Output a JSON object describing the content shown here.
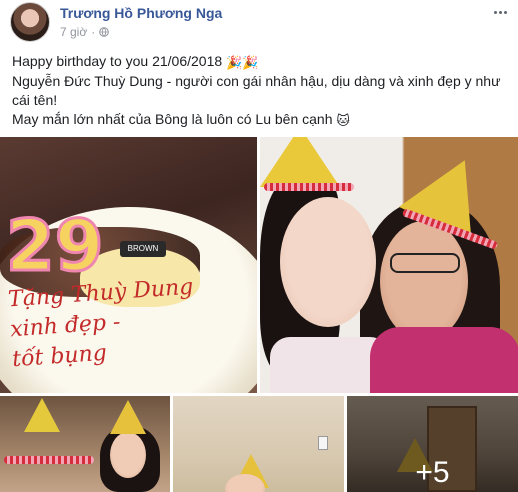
{
  "post": {
    "author": "Trương Hồ Phương Nga",
    "time": "7 giờ",
    "separator": "·",
    "privacy_icon": "globe-icon",
    "more_icon": "more-options-icon",
    "text": {
      "line1": "Happy birthday to you 21/06/2018",
      "line1_emoji": "🎉🎉",
      "line2": "Nguyễn Đức Thuỳ Dung - người con gái nhân hậu, dịu dàng và xinh đẹp y như cái tên!",
      "line3": "May mắn lớn nhất của Bông là luôn có Lu bên cạnh",
      "line3_emoji": "🐱"
    }
  },
  "photos": {
    "cake": {
      "candles": "29",
      "brand": "BROWN",
      "writing_line1": "Tặng Thuỳ Dung",
      "writing_line2": "xinh đẹp -",
      "writing_line3": "tốt bụng"
    },
    "more_count": "+5"
  },
  "colors": {
    "author_link": "#385898",
    "meta_gray": "#90949c",
    "text": "#1c1e21"
  }
}
